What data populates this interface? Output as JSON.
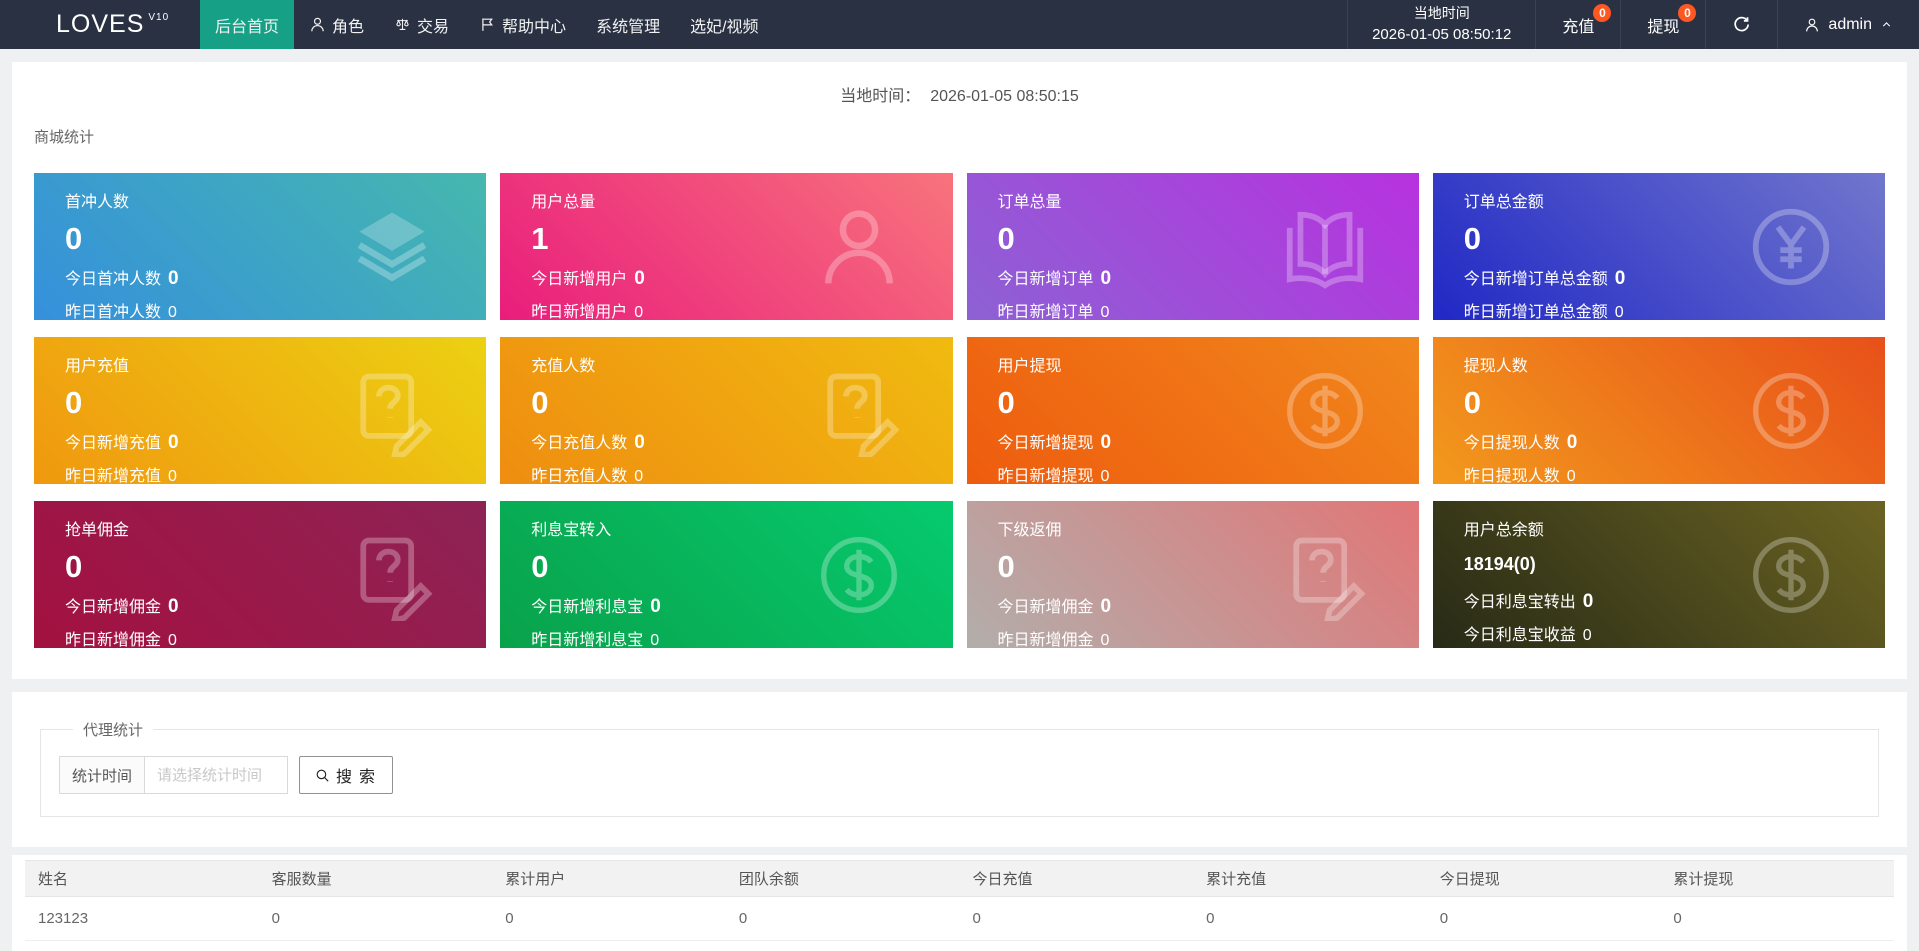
{
  "navbar": {
    "logo": "LOVES",
    "logo_sup": "V10",
    "active_color": "#16a085",
    "badge_color": "#ff5722",
    "items": [
      {
        "label": "后台首页",
        "icon": null,
        "active": true
      },
      {
        "label": "角色",
        "icon": "user-icon",
        "active": false
      },
      {
        "label": "交易",
        "icon": "scales-icon",
        "active": false
      },
      {
        "label": "帮助中心",
        "icon": "flag-icon",
        "active": false
      },
      {
        "label": "系统管理",
        "icon": null,
        "active": false
      },
      {
        "label": "选妃/视频",
        "icon": null,
        "active": false
      }
    ],
    "local_time_label": "当地时间",
    "local_time_value": "2026-01-05 08:50:12",
    "recharge_label": "充值",
    "recharge_badge": "0",
    "withdraw_label": "提现",
    "withdraw_badge": "0",
    "refresh_icon": "refresh-icon",
    "user_icon": "user-icon",
    "username": "admin"
  },
  "panel_time": {
    "label": "当地时间：",
    "value": "2026-01-05 08:50:15"
  },
  "stats": {
    "section_title": "商城统计",
    "cards": [
      {
        "title": "首冲人数",
        "value": "0",
        "line1_label": "今日首冲人数",
        "line1_value": "0",
        "line2_label": "昨日首冲人数",
        "line2_value": "0",
        "icon": "layers-icon",
        "gradient_from": "#3590dc",
        "gradient_to": "#46b8ae"
      },
      {
        "title": "用户总量",
        "value": "1",
        "line1_label": "今日新增用户",
        "line1_value": "0",
        "line2_label": "昨日新增用户",
        "line2_value": "0",
        "icon": "user-icon",
        "gradient_from": "#e91d7c",
        "gradient_to": "#f8737c"
      },
      {
        "title": "订单总量",
        "value": "0",
        "line1_label": "今日新增订单",
        "line1_value": "0",
        "line2_label": "昨日新增订单",
        "line2_value": "0",
        "icon": "book-icon",
        "gradient_from": "#8d61d4",
        "gradient_to": "#b732df"
      },
      {
        "title": "订单总金额",
        "value": "0",
        "line1_label": "今日新增订单总金额",
        "line1_value": "0",
        "line2_label": "昨日新增订单总金额",
        "line2_value": "0",
        "icon": "yen-circle-icon",
        "gradient_from": "#2028c5",
        "gradient_to": "#7176cd"
      },
      {
        "title": "用户充值",
        "value": "0",
        "line1_label": "今日新增充值",
        "line1_value": "0",
        "line2_label": "昨日新增充值",
        "line2_value": "0",
        "icon": "doc-question-icon",
        "gradient_from": "#f0980f",
        "gradient_to": "#ecd112"
      },
      {
        "title": "充值人数",
        "value": "0",
        "line1_label": "今日充值人数",
        "line1_value": "0",
        "line2_label": "昨日充值人数",
        "line2_value": "0",
        "icon": "doc-question-icon",
        "gradient_from": "#ef8d10",
        "gradient_to": "#f0bb10"
      },
      {
        "title": "用户提现",
        "value": "0",
        "line1_label": "今日新增提现",
        "line1_value": "0",
        "line2_label": "昨日新增提现",
        "line2_value": "0",
        "icon": "dollar-circle-icon",
        "gradient_from": "#ee5c0e",
        "gradient_to": "#f1871c"
      },
      {
        "title": "提现人数",
        "value": "0",
        "line1_label": "今日提现人数",
        "line1_value": "0",
        "line2_label": "昨日提现人数",
        "line2_value": "0",
        "icon": "dollar-circle-icon",
        "gradient_from": "#f2991c",
        "gradient_to": "#e8501a"
      },
      {
        "title": "抢单佣金",
        "value": "0",
        "line1_label": "今日新增佣金",
        "line1_value": "0",
        "line2_label": "昨日新增佣金",
        "line2_value": "0",
        "icon": "doc-question-icon",
        "gradient_from": "#a31140",
        "gradient_to": "#8e2355"
      },
      {
        "title": "利息宝转入",
        "value": "0",
        "line1_label": "今日新增利息宝",
        "line1_value": "0",
        "line2_label": "昨日新增利息宝",
        "line2_value": "0",
        "icon": "dollar-circle-icon",
        "gradient_from": "#09a24b",
        "gradient_to": "#06ca6e"
      },
      {
        "title": "下级返佣",
        "value": "0",
        "line1_label": "今日新增佣金",
        "line1_value": "0",
        "line2_label": "昨日新增佣金",
        "line2_value": "0",
        "icon": "doc-question-icon",
        "gradient_from": "#b2aeab",
        "gradient_to": "#e17677"
      },
      {
        "title": "用户总余额",
        "value": "18194(0)",
        "line1_label": "今日利息宝转出",
        "line1_value": "0",
        "line2_label": "今日利息宝收益",
        "line2_value": "0",
        "icon": "dollar-circle-icon",
        "gradient_from": "#272a16",
        "gradient_to": "#6b6322"
      }
    ]
  },
  "agent": {
    "legend": "代理统计",
    "time_label": "统计时间",
    "time_placeholder": "请选择统计时间",
    "search_label": "搜索",
    "search_icon": "search-icon"
  },
  "table": {
    "headers": [
      "姓名",
      "客服数量",
      "累计用户",
      "团队余额",
      "今日充值",
      "累计充值",
      "今日提现",
      "累计提现"
    ],
    "rows": [
      [
        "123123",
        "0",
        "0",
        "0",
        "0",
        "0",
        "0",
        "0"
      ]
    ]
  }
}
